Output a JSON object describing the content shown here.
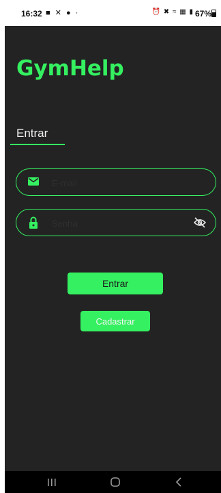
{
  "status_bar": {
    "time": "16:32",
    "battery": "67%",
    "left_icons": [
      "chat-icon",
      "missed-call-icon",
      "notification-icon",
      "dot"
    ],
    "right_icons": [
      "alarm-icon",
      "mute-icon",
      "wifi-icon",
      "volte-icon",
      "signal-icon"
    ]
  },
  "app": {
    "title": "GymHelp"
  },
  "tabs": {
    "login_label": "Entrar"
  },
  "form": {
    "email_placeholder": "E-mail",
    "password_placeholder": "Senha"
  },
  "buttons": {
    "login_label": "Entrar",
    "register_label": "Cadastrar"
  },
  "colors": {
    "accent": "#35f060",
    "background": "#232323"
  },
  "nav_bar": {
    "icons": [
      "recents-icon",
      "home-icon",
      "back-icon"
    ]
  }
}
